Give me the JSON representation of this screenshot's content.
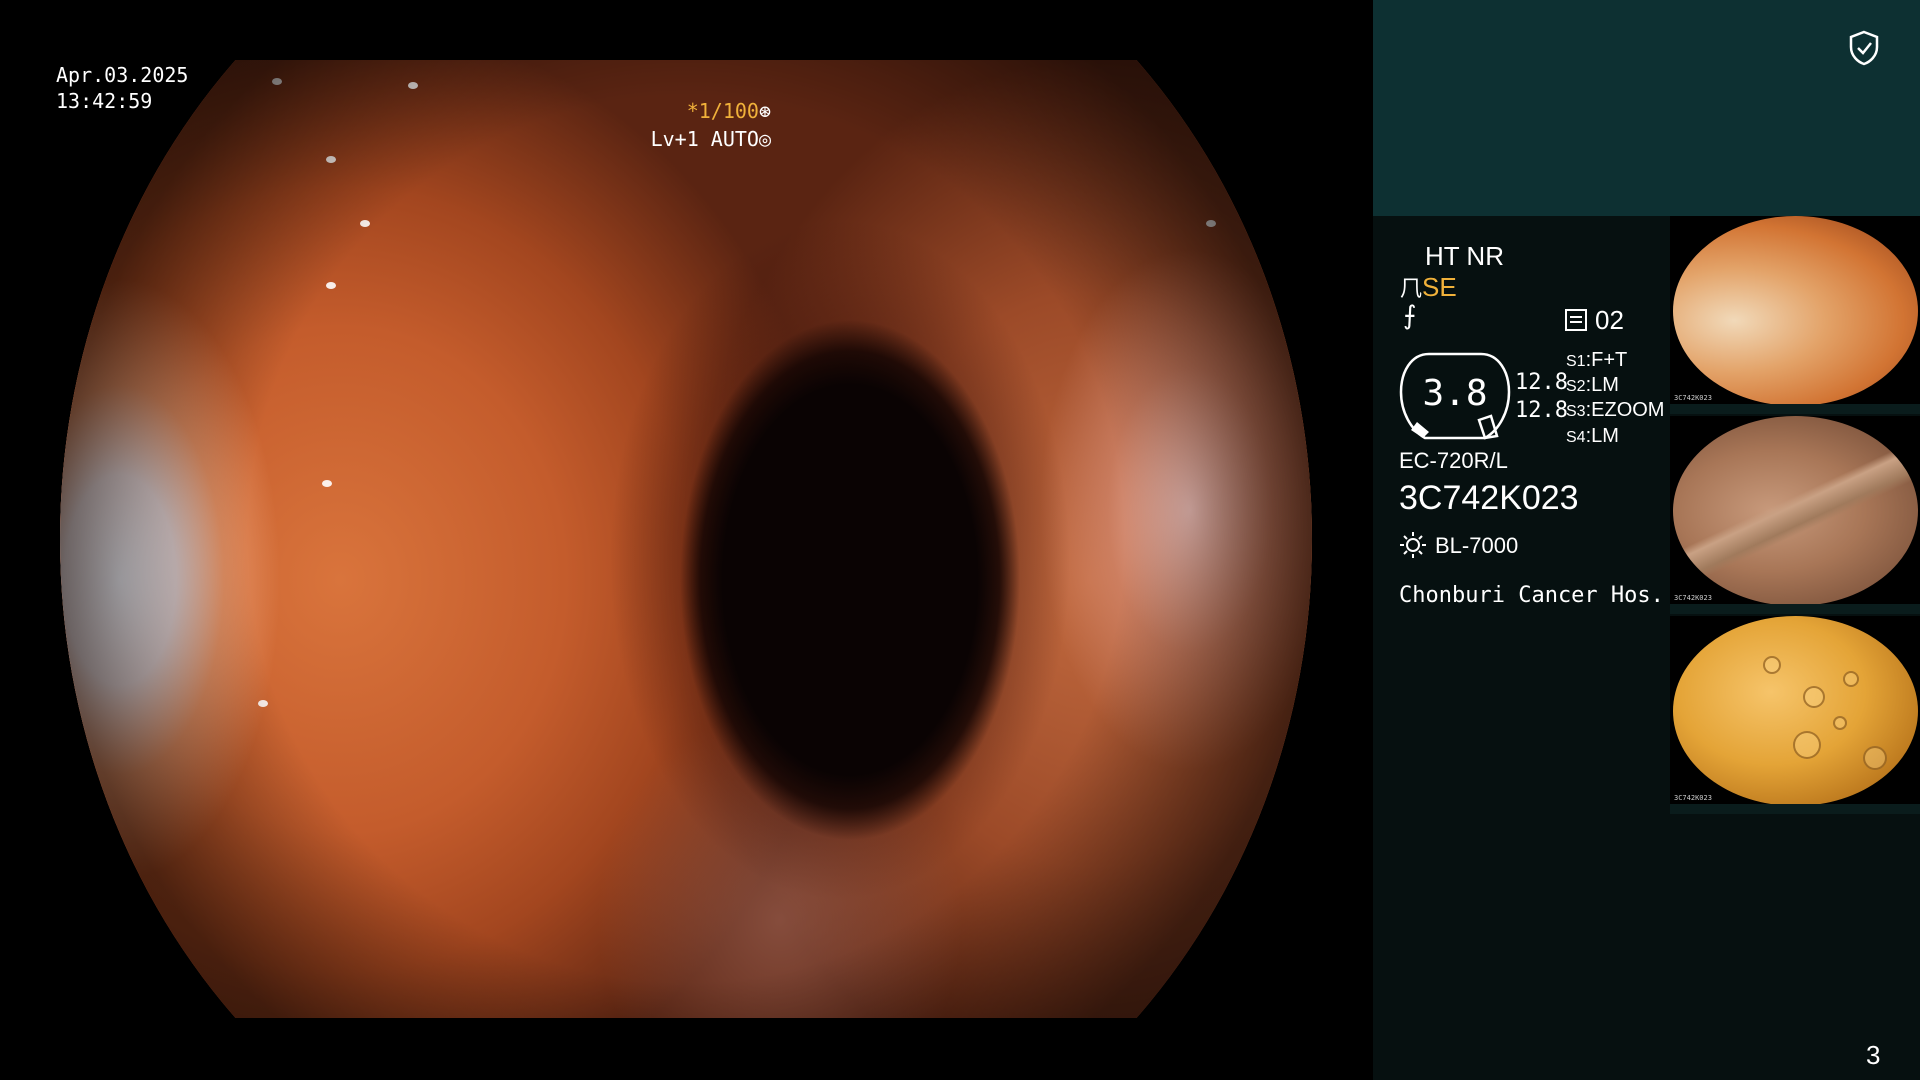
{
  "overlay": {
    "date": "Apr.03.2025",
    "time": "13:42:59",
    "shutter": "*1/100",
    "shutter_icon": "aperture-icon",
    "level": "Lv+1 AUTO",
    "level_icon": "iris-icon"
  },
  "panel": {
    "mode": "HT NR",
    "enhancement": "SE",
    "enhancement_icon": "enhancement-icon",
    "freeze_icon": "freeze-icon",
    "memo_count": "02",
    "gauge_value": "3.8",
    "gauge_sub_top": "12.8",
    "gauge_sub_bottom": "12.8",
    "switches": [
      {
        "key": "S1",
        "value": "F+T"
      },
      {
        "key": "S2",
        "value": "LM"
      },
      {
        "key": "S3",
        "value": "EZOOM"
      },
      {
        "key": "S4",
        "value": "LM"
      }
    ],
    "scope_model": "EC-720R/L",
    "serial": "3C742K023",
    "light_source": "BL-7000",
    "hospital": "Chonburi Cancer Hos.",
    "page_number": "3"
  },
  "thumbnails": [
    {
      "index": "3",
      "mini_id": "3C742K023"
    },
    {
      "index": "2",
      "mini_id": "3C742K023"
    },
    {
      "index": "1",
      "mini_id": "3C742K023"
    }
  ],
  "colors": {
    "accent_yellow": "#f0b13a",
    "panel_dark": "#061010",
    "panel_top": "#0d3032"
  }
}
